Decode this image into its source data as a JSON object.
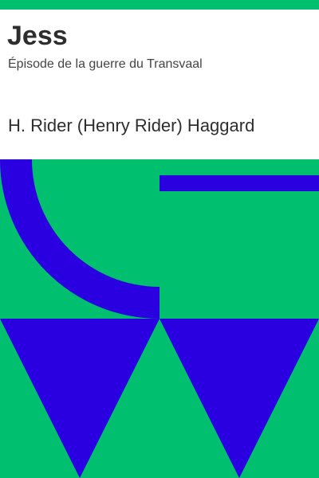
{
  "cover": {
    "title": "Jess",
    "subtitle": "Épisode de la guerre du Transvaal",
    "author": "H. Rider (Henry Rider) Haggard"
  },
  "colors": {
    "accent_green": "#00c070",
    "shape_blue": "#2a00e0",
    "text_dark": "#2e2e2e",
    "text_subtle": "#444444",
    "background": "#ffffff"
  }
}
